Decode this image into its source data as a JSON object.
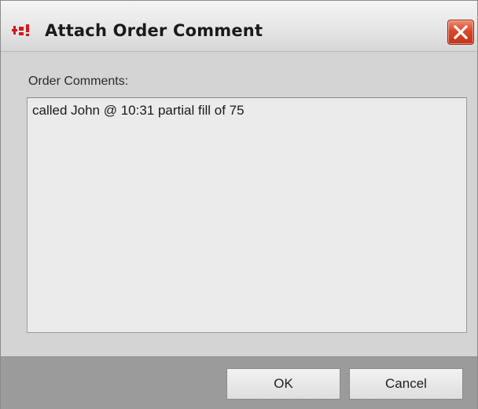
{
  "window": {
    "title": "Attach Order Comment",
    "app_icon": "app-logo-icon",
    "close_icon": "close-icon"
  },
  "form": {
    "comments_label": "Order Comments:",
    "comments_value": "called John @ 10:31 partial fill of 75"
  },
  "buttons": {
    "ok_label": "OK",
    "cancel_label": "Cancel"
  },
  "colors": {
    "close_button": "#d9492a",
    "app_icon": "#d11a1a"
  }
}
